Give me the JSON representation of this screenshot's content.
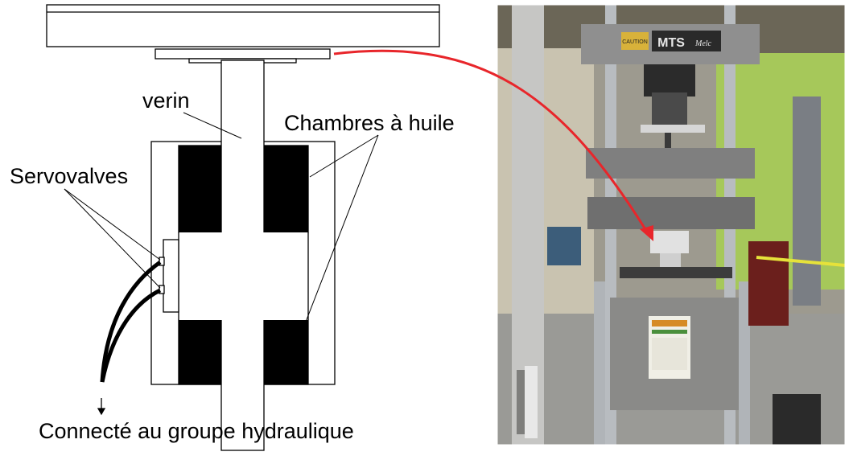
{
  "diagram": {
    "labels": {
      "verin": "verin",
      "chambres": "Chambres à huile",
      "servovalves": "Servovalves",
      "connecte": "Connecté au groupe hydraulique"
    }
  },
  "photo": {
    "brand": "MTS",
    "brand_sub": "Melc",
    "caution": "CAUTION"
  },
  "colors": {
    "arrow": "#e8262b",
    "ink": "#000000",
    "machine_frame": "#8f8f8f",
    "wall_green": "#a6c85a",
    "floor": "#9a9a96"
  }
}
